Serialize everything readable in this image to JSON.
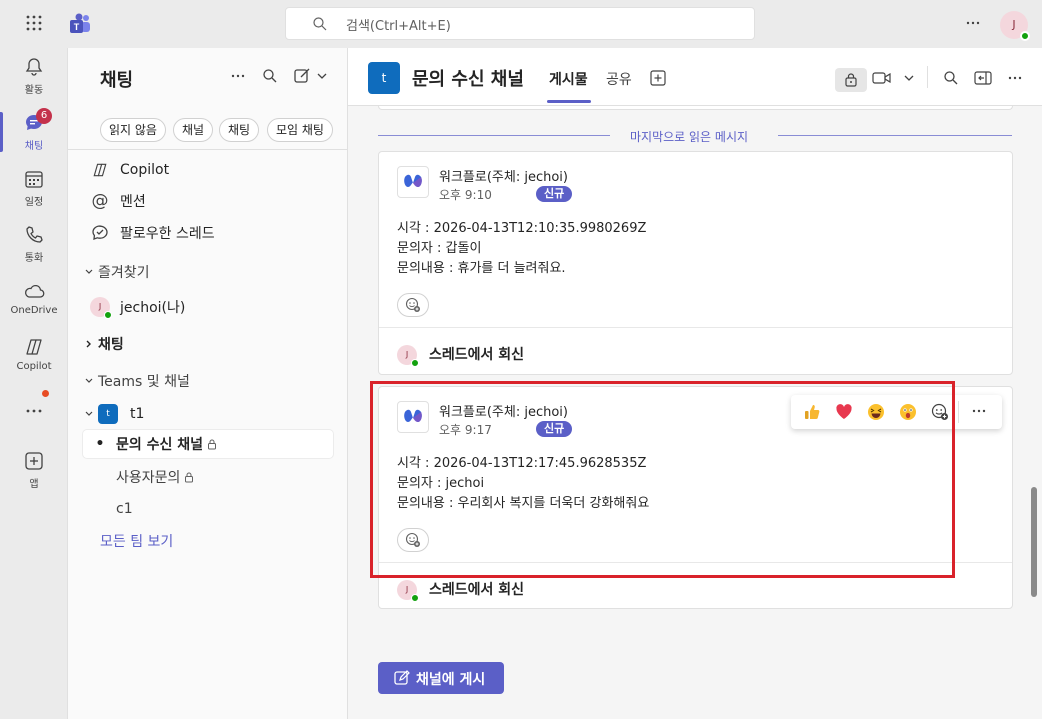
{
  "topbar": {
    "search_placeholder": "검색(Ctrl+Alt+E)",
    "avatar_initial": "J"
  },
  "rail": {
    "items": [
      {
        "label": "활동"
      },
      {
        "label": "채팅",
        "badge": "6"
      },
      {
        "label": "일정"
      },
      {
        "label": "통화"
      },
      {
        "label": "OneDrive"
      },
      {
        "label": "Copilot"
      },
      {
        "label": "앱"
      }
    ]
  },
  "leftpane": {
    "title": "채팅",
    "filters": [
      "읽지 않음",
      "채널",
      "채팅",
      "모임 채팅"
    ],
    "quick": [
      {
        "label": "Copilot"
      },
      {
        "label": "멘션"
      },
      {
        "label": "팔로우한 스레드"
      }
    ],
    "favorites_header": "즐겨찾기",
    "favorite_user": "jechoi(나)",
    "chats_header": "채팅",
    "teams_header": "Teams 및 채널",
    "team_name": "t1",
    "team_initial": "t",
    "channels": [
      {
        "name": "문의 수신 채널"
      },
      {
        "name": "사용자문의"
      },
      {
        "name": "c1"
      }
    ],
    "all_teams_link": "모든 팀 보기"
  },
  "channel": {
    "initial": "t",
    "title": "문의 수신 채널",
    "tabs": [
      "게시물",
      "공유"
    ],
    "last_read_label": "마지막으로 읽은 메시지"
  },
  "posts": [
    {
      "author": "워크플로(주체: jechoi)",
      "time": "오후 9:10",
      "tag": "신규",
      "lines": [
        "시각 : 2026-04-13T12:10:35.9980269Z",
        "문의자 : 갑돌이",
        "문의내용 : 휴가를 더 늘려줘요."
      ],
      "reply_label": "스레드에서 회신"
    },
    {
      "author": "워크플로(주체: jechoi)",
      "time": "오후 9:17",
      "tag": "신규",
      "lines": [
        "시각 : 2026-04-13T12:17:45.9628535Z",
        "문의자 : jechoi",
        "문의내용 : 우리회사 복지를 더욱더 강화해줘요"
      ],
      "reply_label": "스레드에서 회신"
    }
  ],
  "reply_avatar_initial": "J",
  "post_button_label": "채널에 게시",
  "colors": {
    "accent": "#5b5fc7",
    "highlight": "#d9222a",
    "badge": "#c4314b"
  }
}
